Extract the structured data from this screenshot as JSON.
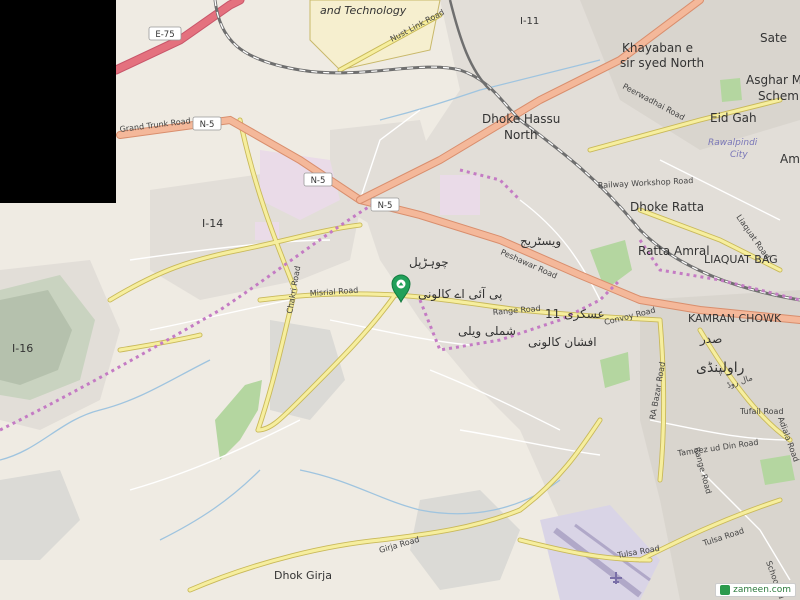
{
  "colors": {
    "land": "#efebe3",
    "urban": "#e0dcd5",
    "park": "#b4d6a0",
    "motorway": "#e4717e",
    "trunk": "#f3b99b",
    "primary": "#f4eb9b",
    "railway": "#777777",
    "boundary": "#c47bc4",
    "pin": "#21a05a",
    "airport": "#d9d4e6",
    "military": "#f2dbe6"
  },
  "labels": {
    "technology": "and Technology",
    "nust_link": "Nust Link Road",
    "i11": "I-11",
    "khayaban1": "Khayaban e",
    "khayaban2": "sir syed North",
    "sate": "Sate",
    "asghar1": "Asghar M",
    "asghar2": "Schem",
    "peerwadhai": "Peerwadhai Road",
    "dhoke_hassu1": "Dhoke Hassu",
    "dhoke_hassu2": "North",
    "eid_gah": "Eid Gah",
    "rawalpindi_city1": "Rawalpindi",
    "rawalpindi_city2": "City",
    "am": "Am",
    "grand_trunk": "Grand Trunk Road",
    "i14": "I-14",
    "railway_workshop": "Railway Workshop Road",
    "dhoke_ratta": "Dhoke Ratta",
    "westridge_ur": "ویسٹریج",
    "choharpul_ur": "چوہڑپل",
    "ratta_amral": "Ratta Amral",
    "liaquat_bag": "LIAQUAT BAG",
    "liaquat_road": "Liaquat Road",
    "peshawar_road": "Peshawar Road",
    "misrial": "Misrial Road",
    "chakri": "Chakri Road",
    "piaa_colony_ur": "پی آئی اے کالونی",
    "askari11_ur": "عسکری 11",
    "range_road": "Range Road",
    "convoy_road": "Convoy Road",
    "kamran_chowk": "KAMRAN CHOWK",
    "saddar_ur": "صدر",
    "shimla_valley_ur": "شملی ویلی",
    "afshan_colony_ur": "افشان کالونی",
    "rawalpindi_ur": "راولپنڈی",
    "mall_road_ur": "مال روڈ",
    "i16": "I-16",
    "ra_bazar": "RA Bazar Road",
    "tufail": "Tufail Road",
    "tameez": "Tameez ud Din Road",
    "adiala": "Adiala Road",
    "range_road2": "Range Road",
    "girja_road": "Girja Road",
    "dhok_girja": "Dhok Girja",
    "tulsa_road1": "Tulsa Road",
    "tulsa_road2": "Tulsa Road",
    "school_road": "School Rd"
  },
  "shields": {
    "e75": "E-75",
    "n5_a": "N-5",
    "n5_b": "N-5",
    "n5_c": "N-5"
  },
  "watermark": {
    "text": "zameen.com"
  }
}
